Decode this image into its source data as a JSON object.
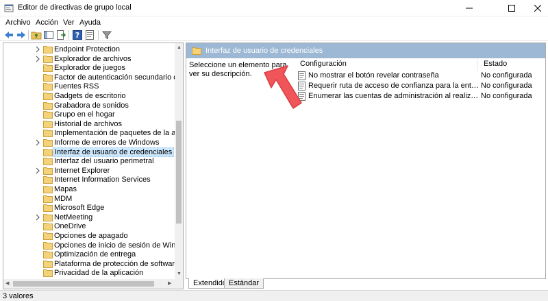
{
  "window": {
    "title": "Editor de directivas de grupo local",
    "icons": {
      "app": "group-policy-app-icon",
      "minimize": "minimize-icon",
      "maximize": "maximize-icon",
      "close": "close-icon"
    }
  },
  "menu": {
    "items": [
      {
        "label": "Archivo",
        "icon": ""
      },
      {
        "label": "Acción"
      },
      {
        "label": "Ver"
      },
      {
        "label": "Ayuda"
      }
    ]
  },
  "toolbar": {
    "buttons": [
      "back-arrow-icon",
      "forward-arrow-icon",
      "up-folder-icon",
      "show-hide-tree-icon",
      "export-list-icon",
      "help-icon",
      "properties-icon",
      "filter-icon"
    ]
  },
  "tree": {
    "items": [
      {
        "label": "Endpoint Protection",
        "expandable": true
      },
      {
        "label": "Explorador de archivos",
        "expandable": true
      },
      {
        "label": "Explorador de juegos",
        "expandable": false
      },
      {
        "label": "Factor de autenticación secundario de Micro",
        "expandable": false
      },
      {
        "label": "Fuentes RSS",
        "expandable": false
      },
      {
        "label": "Gadgets de escritorio",
        "expandable": false
      },
      {
        "label": "Grabadora de sonidos",
        "expandable": false
      },
      {
        "label": "Grupo en el hogar",
        "expandable": false
      },
      {
        "label": "Historial de archivos",
        "expandable": false
      },
      {
        "label": "Implementación de paquetes de la aplicación",
        "expandable": false
      },
      {
        "label": "Informe de errores de Windows",
        "expandable": true
      },
      {
        "label": "Interfaz de usuario de credenciales",
        "expandable": false,
        "selected": true
      },
      {
        "label": "Interfaz del usuario perimetral",
        "expandable": false
      },
      {
        "label": "Internet Explorer",
        "expandable": true
      },
      {
        "label": "Internet Information Services",
        "expandable": false
      },
      {
        "label": "Mapas",
        "expandable": false
      },
      {
        "label": "MDM",
        "expandable": false
      },
      {
        "label": "Microsoft Edge",
        "expandable": false
      },
      {
        "label": "NetMeeting",
        "expandable": true
      },
      {
        "label": "OneDrive",
        "expandable": false
      },
      {
        "label": "Opciones de apagado",
        "expandable": false
      },
      {
        "label": "Opciones de inicio de sesión de Windows",
        "expandable": false
      },
      {
        "label": "Optimización de entrega",
        "expandable": false
      },
      {
        "label": "Plataforma de protección de software",
        "expandable": false
      },
      {
        "label": "Privacidad de la aplicación",
        "expandable": false
      }
    ]
  },
  "details": {
    "header": "Interfaz de usuario de credenciales",
    "description": "Seleccione un elemento para ver su descripción.",
    "columns": {
      "setting": "Configuración",
      "state": "Estado"
    },
    "rows": [
      {
        "setting": "No mostrar el botón revelar contraseña",
        "state": "No configurada"
      },
      {
        "setting": "Requerir ruta de acceso de confianza para la entrada de cred...",
        "state": "No configurada"
      },
      {
        "setting": "Enumerar las cuentas de administración al realizar una eleva...",
        "state": "No configurada"
      }
    ]
  },
  "tabs": [
    {
      "label": "Extendido",
      "active": true
    },
    {
      "label": "Estándar",
      "active": false
    }
  ],
  "status": {
    "text": "3 valores"
  },
  "colors": {
    "header_bg": "#9cb8d4",
    "selection": "#cce8ff",
    "folder": "#e8c35f",
    "annotation": "#f0555a"
  }
}
